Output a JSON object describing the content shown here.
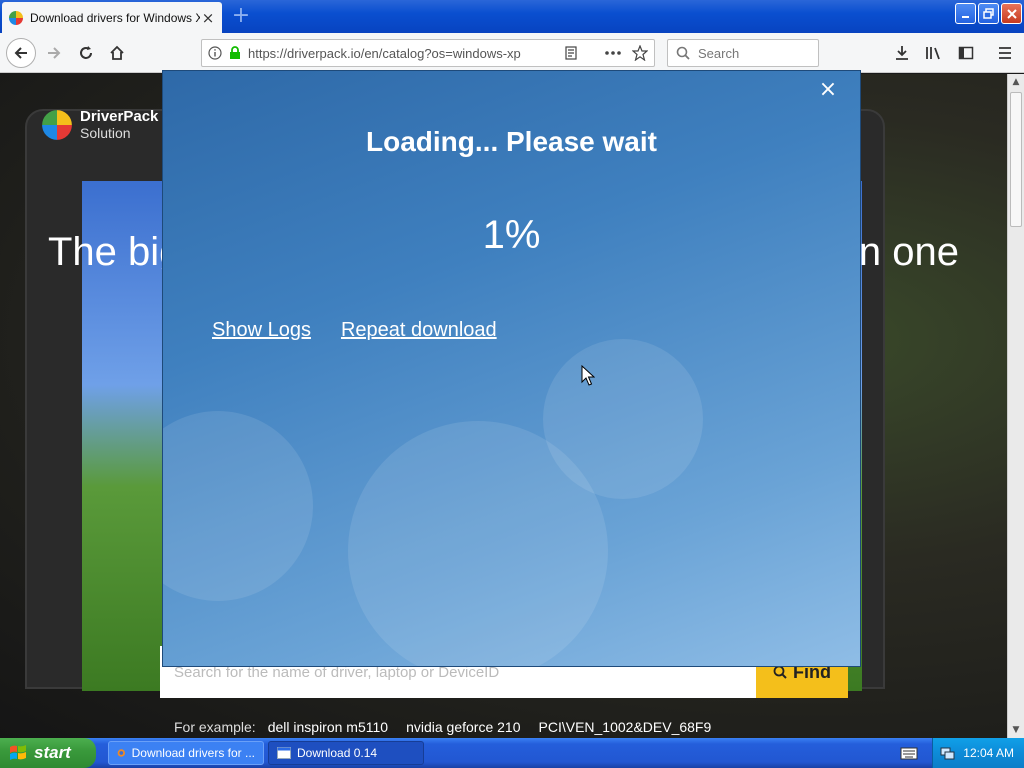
{
  "browser": {
    "tab_title": "Download drivers for Windows XP",
    "url": "https://driverpack.io/en/catalog?os=windows-xp",
    "search_placeholder": "Search"
  },
  "page": {
    "logo_brand": "DriverPack",
    "logo_sub": "Solution",
    "hero_left": "The big",
    "hero_right": "n one",
    "search_placeholder": "Search for the name of driver, laptop or DeviceID",
    "find_label": "Find",
    "examples_label": "For example:",
    "examples": [
      "dell inspiron m5110",
      "nvidia geforce 210",
      "PCI\\VEN_1002&DEV_68F9"
    ]
  },
  "modal": {
    "close_label": "×",
    "title": "Loading... Please wait",
    "progress_text": "1%",
    "progress_value": 0.01,
    "links": [
      "Show Logs",
      "Repeat download"
    ]
  },
  "taskbar": {
    "start_label": "start",
    "tasks": [
      "Download drivers for ...",
      "Download 0.14"
    ],
    "clock": "12:04 AM"
  },
  "colors": {
    "modal_top": "#2e69a8",
    "modal_bottom": "#8fbde6",
    "find_button": "#f4bf1b",
    "taskbar": "#245edb",
    "start_button": "#3a9a3c"
  }
}
